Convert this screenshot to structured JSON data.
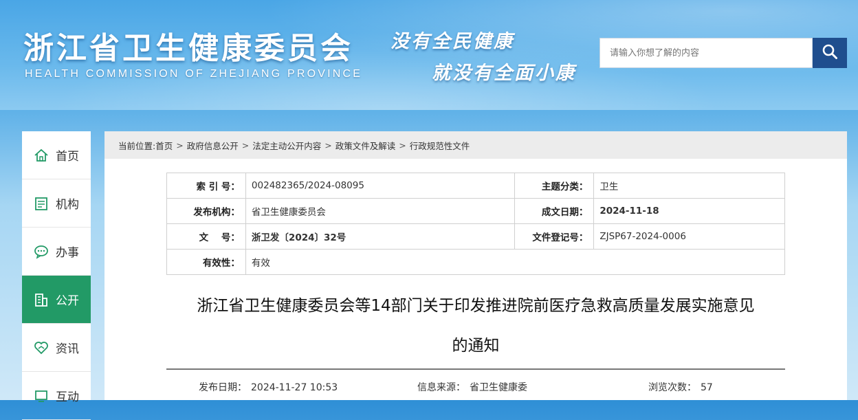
{
  "header": {
    "title": "浙江省卫生健康委员会",
    "subtitle": "HEALTH COMMISSION OF ZHEJIANG PROVINCE",
    "slogan_line1": "没有全民健康",
    "slogan_line2": "就没有全面小康",
    "search": {
      "placeholder": "请输入你想了解的内容",
      "button_icon": "search-icon"
    }
  },
  "sidebar": {
    "items": [
      {
        "label": "首页",
        "icon": "home-icon"
      },
      {
        "label": "机构",
        "icon": "document-icon"
      },
      {
        "label": "办事",
        "icon": "chat-icon"
      },
      {
        "label": "公开",
        "icon": "building-icon",
        "active": true
      },
      {
        "label": "资讯",
        "icon": "handshake-icon"
      },
      {
        "label": "互动",
        "icon": "screen-icon"
      }
    ]
  },
  "breadcrumb": {
    "prefix": "当前位置:",
    "items": [
      "首页",
      "政府信息公开",
      "法定主动公开内容",
      "政策文件及解读",
      "行政规范性文件"
    ],
    "separator": ">"
  },
  "meta": {
    "index_label": "索 引 号：",
    "index_value": "002482365/2024-08095",
    "topic_label": "主题分类：",
    "topic_value": "卫生",
    "publisher_label": "发布机构：",
    "publisher_value": "省卫生健康委员会",
    "created_label": "成文日期：",
    "created_value": "2024-11-18",
    "docno_label": "文    号：",
    "docno_value": "浙卫发〔2024〕32号",
    "regno_label": "文件登记号：",
    "regno_value": "ZJSP67-2024-0006",
    "validity_label": "有效性：",
    "validity_value": "有效"
  },
  "document": {
    "title_line1": "浙江省卫生健康委员会等14部门关于印发推进院前医疗急救高质量发展实施意见",
    "title_line2": "的通知",
    "publish_label": "发布日期：",
    "publish_value": "2024-11-27 10:53",
    "source_label": "信息来源：",
    "source_value": "省卫生健康委",
    "views_label": "浏览次数：",
    "views_value": "57"
  },
  "colors": {
    "active_nav": "#229a66",
    "search_button": "#1f4e8e"
  }
}
